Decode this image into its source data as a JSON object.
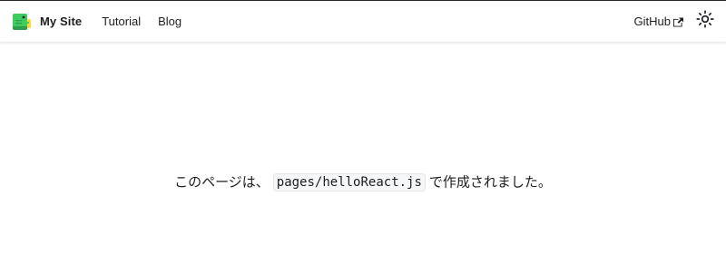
{
  "navbar": {
    "brand_title": "My Site",
    "links": [
      {
        "label": "Tutorial"
      },
      {
        "label": "Blog"
      }
    ],
    "github_label": "GitHub",
    "icons": {
      "logo": "dinosaur-logo-icon",
      "external": "external-link-icon",
      "theme": "sun-icon"
    }
  },
  "main": {
    "message_prefix": "このページは、",
    "file_name": "pages/helloReact.js",
    "message_suffix": "で作成されました。"
  },
  "colors": {
    "logo_green": "#3ecc5f",
    "text": "#1c1e21",
    "code_bg": "#f6f7f8"
  }
}
